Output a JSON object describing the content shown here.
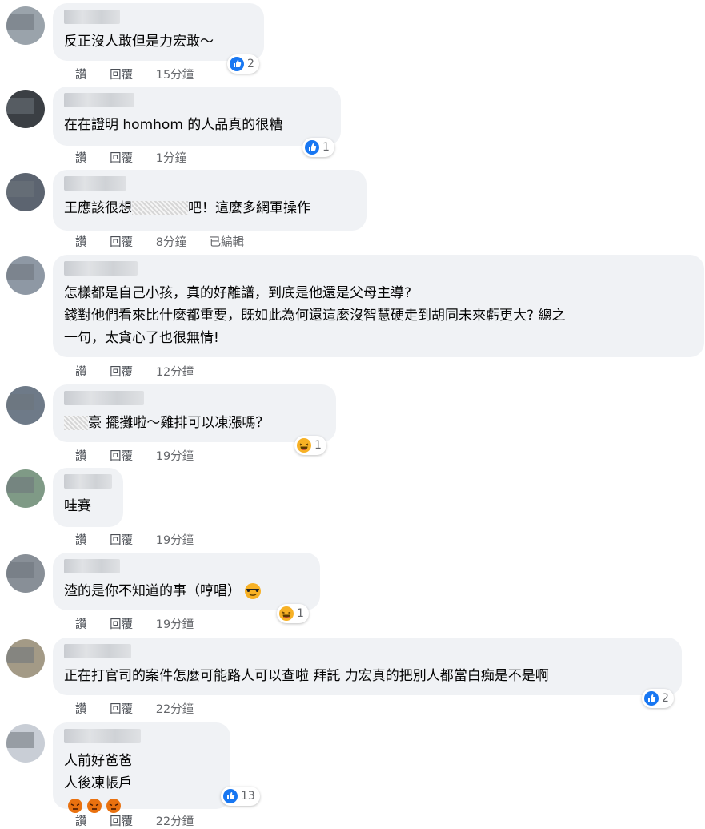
{
  "actions": {
    "like": "讚",
    "reply": "回覆",
    "edited": "已編輯"
  },
  "comments": [
    {
      "text": "反正沒人敢但是力宏敢～",
      "time": "15分鐘",
      "reactions": "2"
    },
    {
      "text": "在在證明 homhom 的人品真的很糟",
      "time": "1分鐘",
      "reactions": "1"
    },
    {
      "text_a": "王應該很想",
      "text_b": "吧！這麼多網軍操作",
      "time": "8分鐘"
    },
    {
      "text": "怎樣都是自己小孩，真的好離譜，到底是他還是父母主導?\n錢對他們看來比什麼都重要，既如此為何還這麼沒智慧硬走到胡同未來虧更大? 總之\n一句，太貪心了也很無情!",
      "time": "12分鐘"
    },
    {
      "text_a": "豪",
      "text_b": "擺攤啦～雞排可以凍漲嗎？",
      "time": "19分鐘",
      "reactions": "1"
    },
    {
      "text": "哇賽",
      "time": "19分鐘"
    },
    {
      "text": "渣的是你不知道的事（哼唱）",
      "time": "19分鐘",
      "reactions": "1"
    },
    {
      "text": "正在打官司的案件怎麼可能路人可以查啦 拜託 力宏真的把別人都當白痴是不是啊",
      "time": "22分鐘",
      "reactions": "2"
    },
    {
      "line1": "人前好爸爸",
      "line2": "人後凍帳戶",
      "time": "22分鐘",
      "reactions": "13"
    }
  ],
  "colors": {
    "like_blue": "#1877f2",
    "bubble": "#f0f2f5",
    "haha_yellow": "#f7b125",
    "angry_orange": "#e9710f"
  }
}
